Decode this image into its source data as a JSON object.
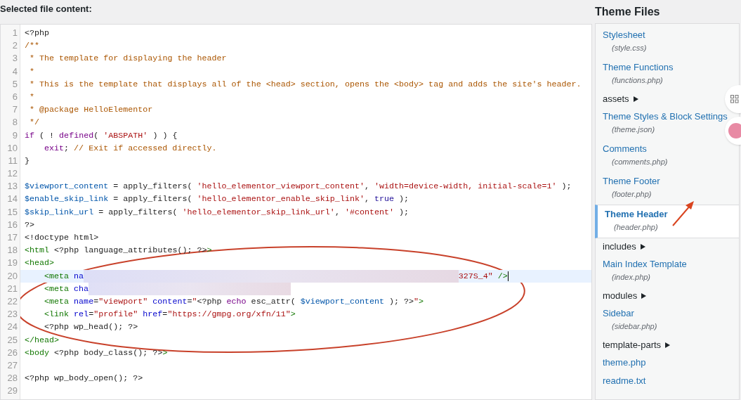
{
  "header": {
    "title": "Selected file content:"
  },
  "editor": {
    "lines": [
      {
        "number": "1",
        "selected": false,
        "indented": false,
        "tokens": [
          {
            "kind": "plain",
            "text": "<?php"
          }
        ]
      },
      {
        "number": "2",
        "selected": false,
        "indented": false,
        "tokens": [
          {
            "kind": "comment",
            "text": "/**"
          }
        ]
      },
      {
        "number": "3",
        "selected": false,
        "indented": false,
        "tokens": [
          {
            "kind": "comment",
            "text": " * The template for displaying the header"
          }
        ]
      },
      {
        "number": "4",
        "selected": false,
        "indented": false,
        "tokens": [
          {
            "kind": "comment",
            "text": " *"
          }
        ]
      },
      {
        "number": "5",
        "selected": false,
        "indented": false,
        "tokens": [
          {
            "kind": "comment",
            "text": " * This is the template that displays all of the <head> section, opens the <body> tag and adds the site's header."
          }
        ]
      },
      {
        "number": "6",
        "selected": false,
        "indented": false,
        "tokens": [
          {
            "kind": "comment",
            "text": " *"
          }
        ]
      },
      {
        "number": "7",
        "selected": false,
        "indented": false,
        "tokens": [
          {
            "kind": "comment",
            "text": " * @package HelloElementor"
          }
        ]
      },
      {
        "number": "8",
        "selected": false,
        "indented": false,
        "tokens": [
          {
            "kind": "comment",
            "text": " */"
          }
        ]
      },
      {
        "number": "9",
        "selected": false,
        "indented": false,
        "tokens": [
          {
            "kind": "keyword",
            "text": "if"
          },
          {
            "kind": "plain",
            "text": " ( ! "
          },
          {
            "kind": "keyword",
            "text": "defined"
          },
          {
            "kind": "plain",
            "text": "( "
          },
          {
            "kind": "string",
            "text": "'ABSPATH'"
          },
          {
            "kind": "plain",
            "text": " ) ) {"
          }
        ]
      },
      {
        "number": "10",
        "selected": false,
        "indented": true,
        "tokens": [
          {
            "kind": "keyword",
            "text": "exit"
          },
          {
            "kind": "plain",
            "text": "; "
          },
          {
            "kind": "comment",
            "text": "// Exit if accessed directly."
          }
        ]
      },
      {
        "number": "11",
        "selected": false,
        "indented": false,
        "tokens": [
          {
            "kind": "plain",
            "text": "}"
          }
        ]
      },
      {
        "number": "12",
        "selected": false,
        "indented": false
      },
      {
        "number": "13",
        "selected": false,
        "indented": false,
        "tokens": [
          {
            "kind": "variable",
            "text": "$viewport_content"
          },
          {
            "kind": "plain",
            "text": " = apply_filters( "
          },
          {
            "kind": "string",
            "text": "'hello_elementor_viewport_content'"
          },
          {
            "kind": "plain",
            "text": ", "
          },
          {
            "kind": "string",
            "text": "'width=device-width, initial-scale=1'"
          },
          {
            "kind": "plain",
            "text": " );"
          }
        ]
      },
      {
        "number": "14",
        "selected": false,
        "indented": false,
        "tokens": [
          {
            "kind": "variable",
            "text": "$enable_skip_link"
          },
          {
            "kind": "plain",
            "text": " = apply_filters( "
          },
          {
            "kind": "string",
            "text": "'hello_elementor_enable_skip_link'"
          },
          {
            "kind": "plain",
            "text": ", "
          },
          {
            "kind": "atom",
            "text": "true"
          },
          {
            "kind": "plain",
            "text": " );"
          }
        ]
      },
      {
        "number": "15",
        "selected": false,
        "indented": false,
        "tokens": [
          {
            "kind": "variable",
            "text": "$skip_link_url"
          },
          {
            "kind": "plain",
            "text": " = apply_filters( "
          },
          {
            "kind": "string",
            "text": "'hello_elementor_skip_link_url'"
          },
          {
            "kind": "plain",
            "text": ", "
          },
          {
            "kind": "string",
            "text": "'#content'"
          },
          {
            "kind": "plain",
            "text": " );"
          }
        ]
      },
      {
        "number": "16",
        "selected": false,
        "indented": false,
        "tokens": [
          {
            "kind": "plain",
            "text": "?>"
          }
        ]
      },
      {
        "number": "17",
        "selected": false,
        "indented": false,
        "tokens": [
          {
            "kind": "plain",
            "text": "<!doctype html>"
          }
        ]
      },
      {
        "number": "18",
        "selected": false,
        "indented": false,
        "tokens": [
          {
            "kind": "tag",
            "text": "<html"
          },
          {
            "kind": "plain",
            "text": " <?php language_attributes(); ?>"
          },
          {
            "kind": "tag",
            "text": ">"
          }
        ]
      },
      {
        "number": "19",
        "selected": false,
        "indented": false,
        "tokens": [
          {
            "kind": "tag",
            "text": "<head>"
          }
        ]
      },
      {
        "number": "20",
        "selected": true,
        "indented": true,
        "tokens": [
          {
            "kind": "tag",
            "text": "<meta"
          },
          {
            "kind": "attribute",
            "text": " na"
          },
          {
            "kind": "redacted"
          },
          {
            "kind": "string",
            "text": "327S_4\""
          },
          {
            "kind": "tag",
            "text": " />"
          }
        ]
      },
      {
        "number": "21",
        "selected": false,
        "indented": true,
        "tokens": [
          {
            "kind": "tag",
            "text": "<meta"
          },
          {
            "kind": "attribute",
            "text": " cha"
          },
          {
            "kind": "redacted"
          }
        ]
      },
      {
        "number": "22",
        "selected": false,
        "indented": true,
        "tokens": [
          {
            "kind": "tag",
            "text": "<meta"
          },
          {
            "kind": "attribute",
            "text": " name"
          },
          {
            "kind": "plain",
            "text": "="
          },
          {
            "kind": "string",
            "text": "\"viewport\""
          },
          {
            "kind": "attribute",
            "text": " content"
          },
          {
            "kind": "plain",
            "text": "="
          },
          {
            "kind": "string",
            "text": "\""
          },
          {
            "kind": "plain",
            "text": "<?php "
          },
          {
            "kind": "keyword",
            "text": "echo"
          },
          {
            "kind": "plain",
            "text": " esc_attr( "
          },
          {
            "kind": "variable",
            "text": "$viewport_content"
          },
          {
            "kind": "plain",
            "text": " ); ?>"
          },
          {
            "kind": "string",
            "text": "\""
          },
          {
            "kind": "tag",
            "text": ">"
          }
        ]
      },
      {
        "number": "23",
        "selected": false,
        "indented": true,
        "tokens": [
          {
            "kind": "tag",
            "text": "<link"
          },
          {
            "kind": "attribute",
            "text": " rel"
          },
          {
            "kind": "plain",
            "text": "="
          },
          {
            "kind": "string",
            "text": "\"profile\""
          },
          {
            "kind": "attribute",
            "text": " href"
          },
          {
            "kind": "plain",
            "text": "="
          },
          {
            "kind": "string",
            "text": "\"https://gmpg.org/xfn/11\""
          },
          {
            "kind": "tag",
            "text": ">"
          }
        ]
      },
      {
        "number": "24",
        "selected": false,
        "indented": true,
        "tokens": [
          {
            "kind": "plain",
            "text": "<?php wp_head(); ?>"
          }
        ]
      },
      {
        "number": "25",
        "selected": false,
        "indented": false,
        "tokens": [
          {
            "kind": "tag",
            "text": "</head>"
          }
        ]
      },
      {
        "number": "26",
        "selected": false,
        "indented": false,
        "tokens": [
          {
            "kind": "tag",
            "text": "<body"
          },
          {
            "kind": "plain",
            "text": " <?php body_class(); ?>"
          },
          {
            "kind": "tag",
            "text": ">"
          }
        ]
      },
      {
        "number": "27",
        "selected": false,
        "indented": false
      },
      {
        "number": "28",
        "selected": false,
        "indented": false,
        "tokens": [
          {
            "kind": "plain",
            "text": "<?php wp_body_open(); ?>"
          }
        ]
      },
      {
        "number": "29",
        "selected": false,
        "indented": false
      }
    ]
  },
  "sidebar": {
    "title": "Theme Files",
    "items": [
      {
        "kind": "file",
        "label": "Stylesheet",
        "filename": "(style.css)",
        "selected": false
      },
      {
        "kind": "file",
        "label": "Theme Functions",
        "filename": "(functions.php)",
        "selected": false
      },
      {
        "kind": "folder",
        "label": "assets",
        "expanded": false,
        "selected": false
      },
      {
        "kind": "file",
        "label": "Theme Styles & Block Settings",
        "filename": "(theme.json)",
        "selected": false
      },
      {
        "kind": "file",
        "label": "Comments",
        "filename": "(comments.php)",
        "selected": false
      },
      {
        "kind": "file",
        "label": "Theme Footer",
        "filename": "(footer.php)",
        "selected": false
      },
      {
        "kind": "file",
        "label": "Theme Header",
        "filename": "(header.php)",
        "selected": true
      },
      {
        "kind": "folder",
        "label": "includes",
        "expanded": false,
        "selected": false
      },
      {
        "kind": "file",
        "label": "Main Index Template",
        "filename": "(index.php)",
        "selected": false
      },
      {
        "kind": "folder",
        "label": "modules",
        "expanded": false,
        "selected": false
      },
      {
        "kind": "file",
        "label": "Sidebar",
        "filename": "(sidebar.php)",
        "selected": false
      },
      {
        "kind": "folder",
        "label": "template-parts",
        "expanded": false,
        "selected": false
      },
      {
        "kind": "link",
        "label": "theme.php",
        "selected": false
      },
      {
        "kind": "link",
        "label": "readme.txt",
        "selected": false
      }
    ]
  },
  "annotations": {
    "circled_lines": true,
    "pointer_arrow": true
  }
}
